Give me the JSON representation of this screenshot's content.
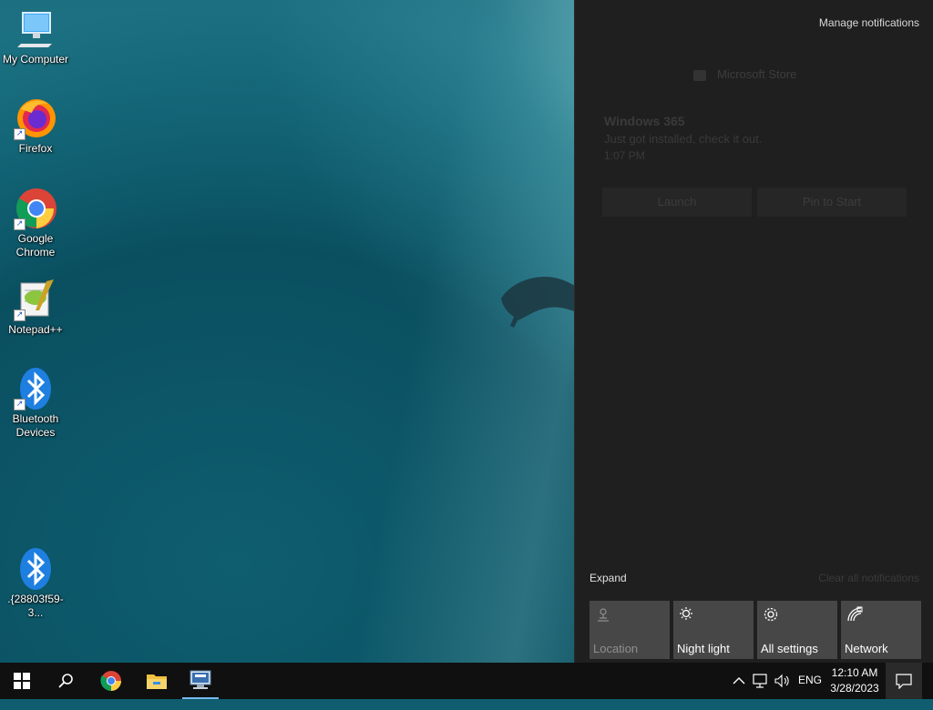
{
  "desktop": {
    "icons": [
      {
        "label": "My Computer"
      },
      {
        "label": "Firefox"
      },
      {
        "label": "Google Chrome"
      },
      {
        "label": "Notepad++"
      },
      {
        "label": "Bluetooth Devices"
      },
      {
        "label": ".{28803f59-3..."
      }
    ]
  },
  "action_center": {
    "manage_label": "Manage notifications",
    "group_header": "Microsoft Store",
    "notification": {
      "title": "Windows 365",
      "body": "Just got installed, check it out.",
      "time": "1:07 PM",
      "buttons": [
        "Launch",
        "Pin to Start"
      ]
    },
    "expand_label": "Expand",
    "clear_label": "Clear all notifications",
    "tiles": [
      {
        "label": "Location",
        "icon": "location-icon",
        "enabled": false
      },
      {
        "label": "Night light",
        "icon": "night-light-icon",
        "enabled": true
      },
      {
        "label": "All settings",
        "icon": "gear-icon",
        "enabled": true
      },
      {
        "label": "Network",
        "icon": "network-icon",
        "enabled": true
      }
    ]
  },
  "taskbar": {
    "apps": [
      "start-icon",
      "search-icon",
      "chrome-icon",
      "file-explorer-icon",
      "remote-desktop-icon"
    ],
    "tray": {
      "language": "ENG",
      "time": "12:10 AM",
      "date": "3/28/2023"
    }
  },
  "colors": {
    "action_center_bg": "#1f1f1f",
    "tile_bg": "#474747",
    "taskbar_bg": "#101010",
    "accent": "#76b9ed"
  }
}
